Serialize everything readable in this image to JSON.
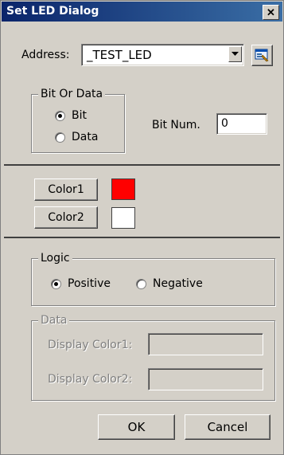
{
  "title": "Set LED Dialog",
  "close_glyph": "✕",
  "address": {
    "label": "Address:",
    "value": "_TEST_LED",
    "dropdown_icon": "chevron-down-icon",
    "browse_icon": "tag-browse-icon"
  },
  "bit_or_data": {
    "title": "Bit Or Data",
    "options": [
      {
        "label": "Bit",
        "checked": true
      },
      {
        "label": "Data",
        "checked": false
      }
    ],
    "bit_num_label": "Bit Num.",
    "bit_num_value": "0"
  },
  "colors": {
    "color1_label": "Color1",
    "color1_value": "#ff0000",
    "color2_label": "Color2",
    "color2_value": "#ffffff"
  },
  "logic": {
    "title": "Logic",
    "options": [
      {
        "label": "Positive",
        "checked": true
      },
      {
        "label": "Negative",
        "checked": false
      }
    ]
  },
  "data_group": {
    "title": "Data",
    "display_color1_label": "Display Color1:",
    "display_color1_value": "",
    "display_color2_label": "Display Color2:",
    "display_color2_value": ""
  },
  "buttons": {
    "ok": "OK",
    "cancel": "Cancel"
  }
}
